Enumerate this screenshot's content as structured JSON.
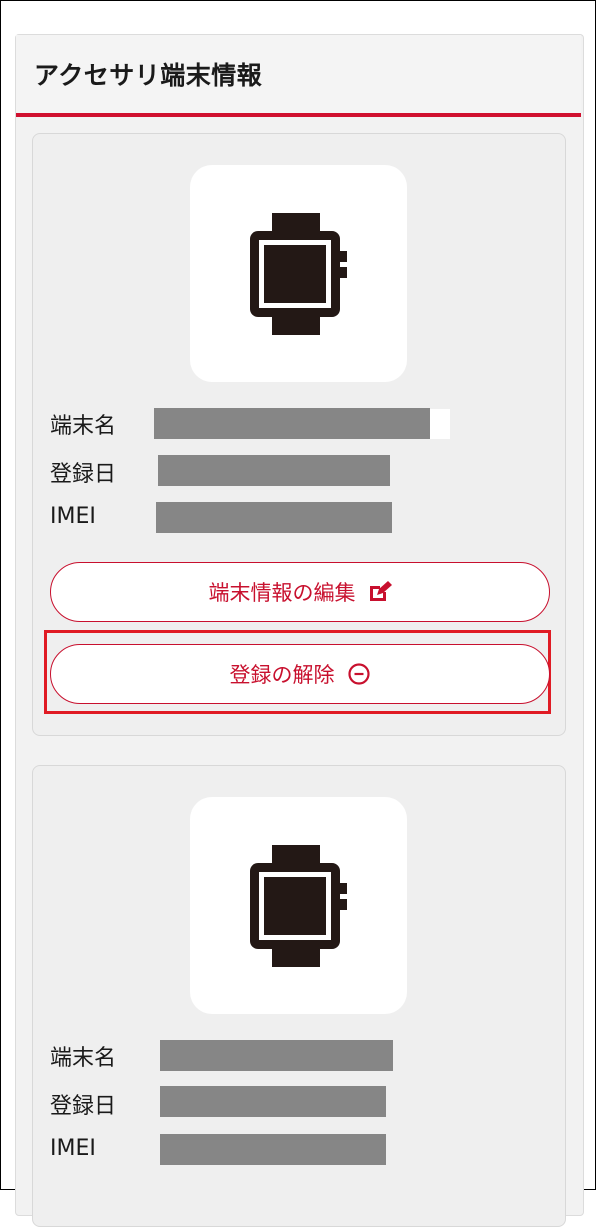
{
  "section": {
    "title": "アクセサリ端末情報"
  },
  "devices": [
    {
      "image_icon": "smartwatch-icon",
      "fields": [
        {
          "label": "端末名"
        },
        {
          "label": "登録日"
        },
        {
          "label": "IMEI"
        }
      ],
      "edit_button": {
        "label": "端末情報の編集",
        "icon": "edit-icon"
      },
      "unregister_button": {
        "label": "登録の解除",
        "icon": "minus-circle-icon"
      }
    },
    {
      "image_icon": "smartwatch-icon",
      "fields": [
        {
          "label": "端末名"
        },
        {
          "label": "登録日"
        },
        {
          "label": "IMEI"
        }
      ]
    }
  ],
  "colors": {
    "accent": "#c8102e",
    "highlight": "#e01b24",
    "redaction": "#868686"
  }
}
